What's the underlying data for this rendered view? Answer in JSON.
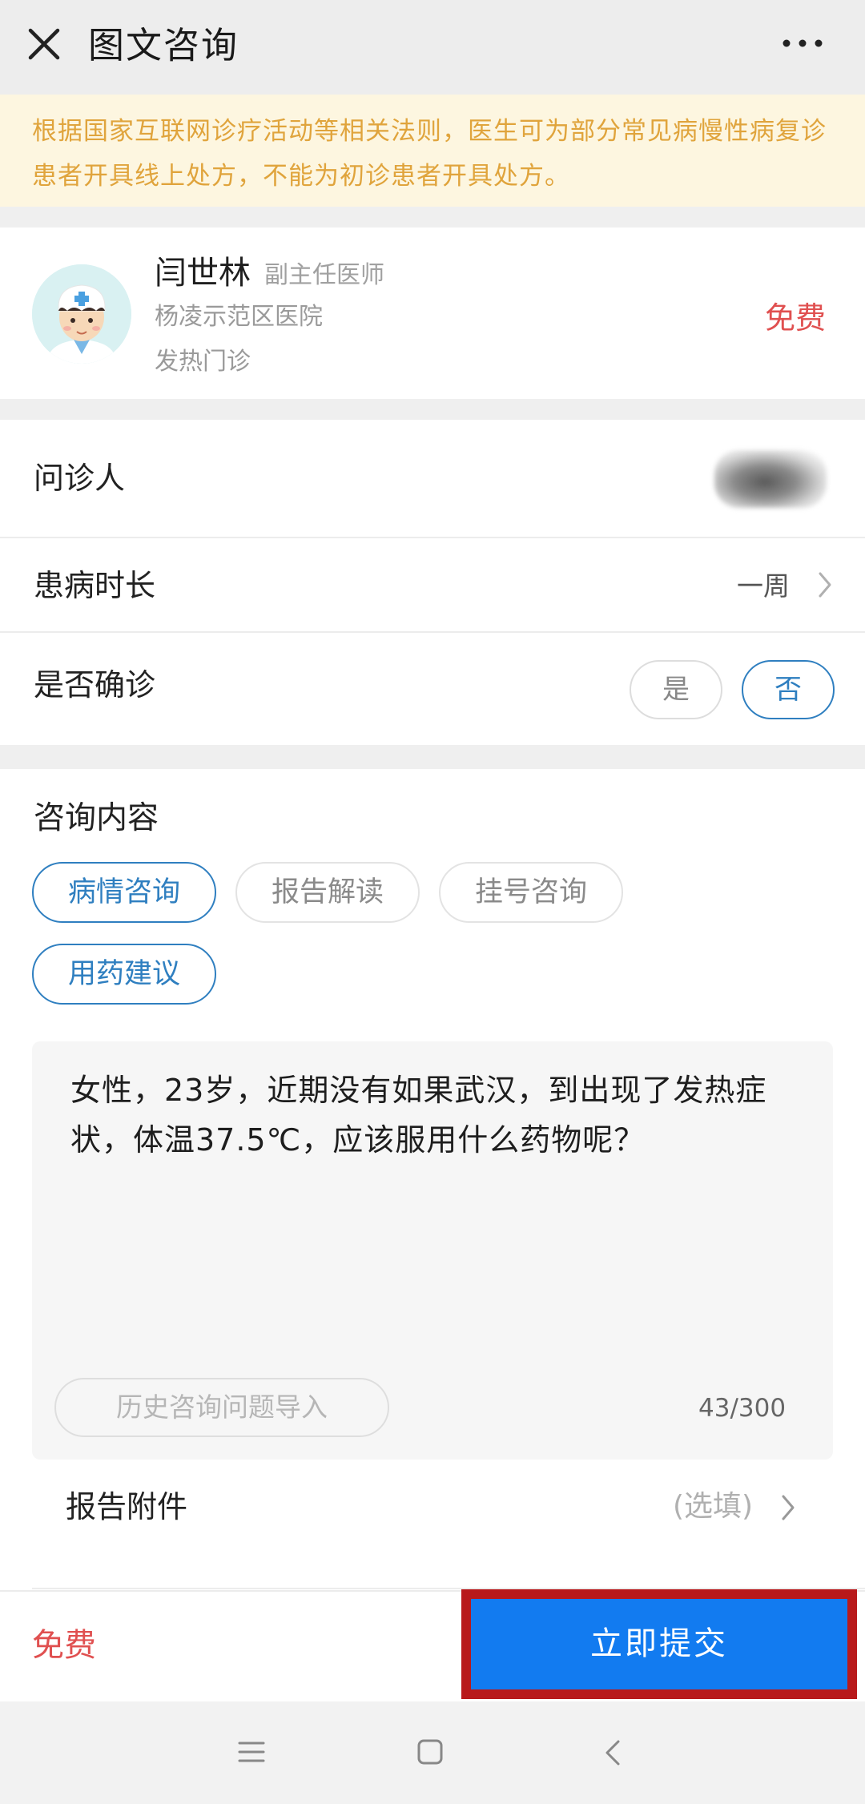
{
  "header": {
    "title": "图文咨询"
  },
  "notice": {
    "text": "根据国家互联网诊疗活动等相关法则，医生可为部分常见病慢性病复诊患者开具线上处方，不能为初诊患者开具处方。"
  },
  "doctor": {
    "name": "闫世林",
    "rank": "副主任医师",
    "hospital": "杨凌示范区医院",
    "department": "发热门诊",
    "price": "免费"
  },
  "form": {
    "patient_label": "问诊人",
    "duration_label": "患病时长",
    "duration_value": "一周",
    "diagnosed_label": "是否确诊",
    "diagnosed_options": [
      "是",
      "否"
    ],
    "diagnosed_selected": "否"
  },
  "consult": {
    "title": "咨询内容",
    "tags": [
      "病情咨询",
      "报告解读",
      "挂号咨询",
      "用药建议"
    ],
    "selected_tags": [
      "病情咨询",
      "用药建议"
    ],
    "question": "女性，23岁，近期没有如果武汉，到出现了发热症状，体温37.5℃，应该服用什么药物呢？",
    "history_button": "历史咨询问题导入",
    "counter": "43/300",
    "attachment_label": "报告附件",
    "attachment_hint": "(选填)"
  },
  "bottom": {
    "price": "免费",
    "submit_label": "立即提交"
  },
  "colors": {
    "accent": "#2f7fc0",
    "submit": "#127bf0",
    "price": "#e05050",
    "notice": "#e0a43c",
    "highlight_border": "#b8191b"
  },
  "icons": [
    "close-icon",
    "more-icon",
    "chevron-right-icon",
    "menu-icon",
    "home-icon",
    "back-icon"
  ]
}
